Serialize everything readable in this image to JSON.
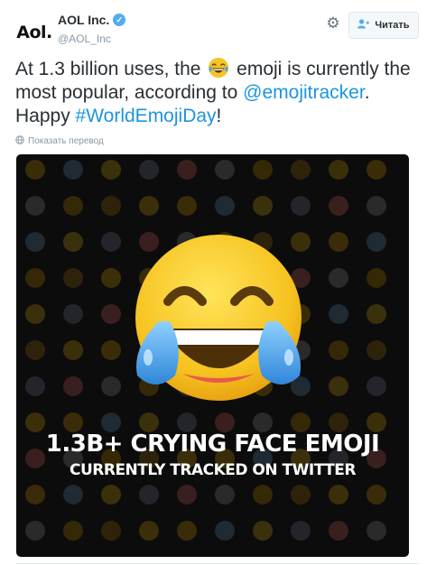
{
  "account": {
    "avatar_text": "Aol.",
    "display_name": "AOL Inc.",
    "handle": "@AOL_Inc",
    "verified": true,
    "verified_icon": "check-icon"
  },
  "actions": {
    "settings_icon": "gear-icon",
    "follow_label": "Читать",
    "follow_icon": "add-user-icon"
  },
  "tweet": {
    "text_part1": "At 1.3 billion uses, the",
    "emoji_name": "face-with-tears-of-joy",
    "text_part2": "emoji is currently the most popular, according to",
    "mention": "@emojitracker",
    "text_part3": ".",
    "text_part4": "Happy",
    "hashtag": "#WorldEmojiDay",
    "text_part5": "!",
    "link_color": "#1b95e0"
  },
  "translate": {
    "label": "Показать перевод",
    "icon": "globe-icon"
  },
  "media": {
    "headline_line1": "1.3B+ CRYING FACE EMOJI",
    "headline_line2": "CURRENTLY TRACKED ON TWITTER",
    "background_color": "#0c0c0c"
  }
}
